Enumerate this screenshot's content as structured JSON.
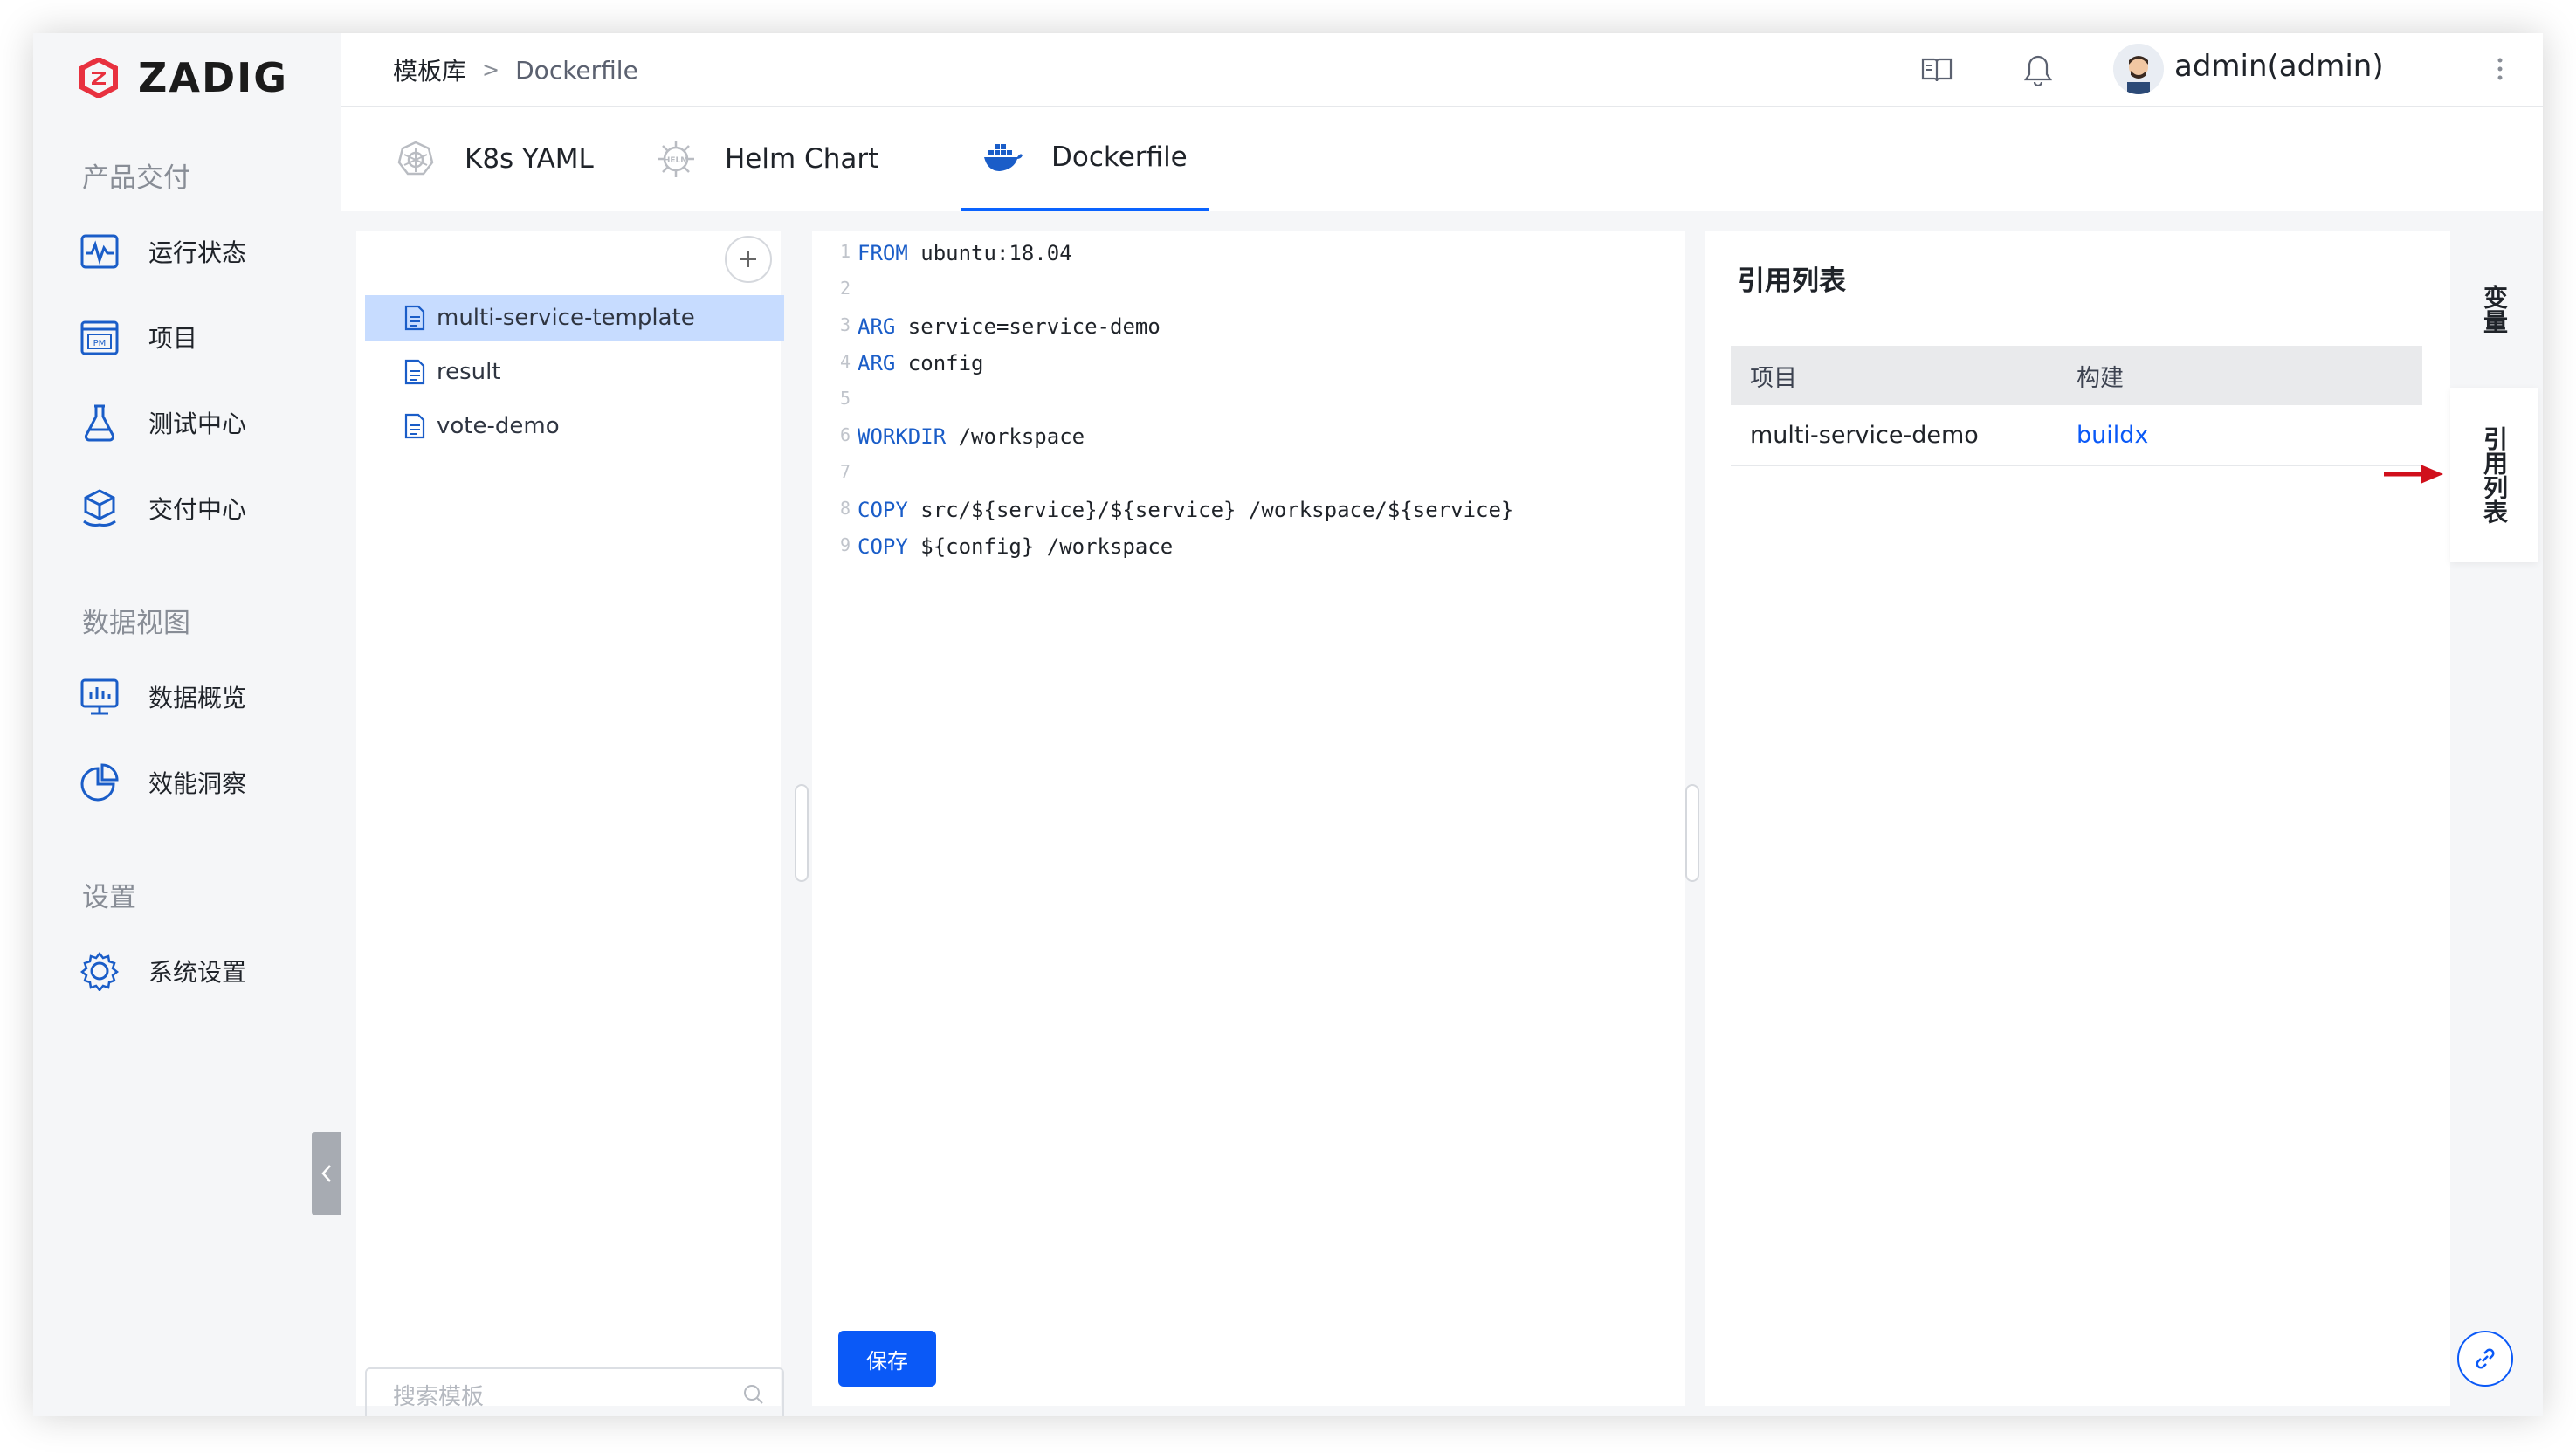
{
  "app": {
    "brand": "ZADIG"
  },
  "sidebar": {
    "section_delivery": "产品交付",
    "section_data": "数据视图",
    "section_settings": "设置",
    "items": [
      {
        "label": "运行状态",
        "icon": "pulse-monitor-icon"
      },
      {
        "label": "项目",
        "icon": "project-pm-icon"
      },
      {
        "label": "测试中心",
        "icon": "flask-icon"
      },
      {
        "label": "交付中心",
        "icon": "package-icon"
      },
      {
        "label": "数据概览",
        "icon": "bar-chart-monitor-icon"
      },
      {
        "label": "效能洞察",
        "icon": "pie-chart-icon"
      },
      {
        "label": "系统设置",
        "icon": "gear-icon"
      }
    ]
  },
  "header": {
    "breadcrumb_root": "模板库",
    "breadcrumb_sep": ">",
    "breadcrumb_current": "Dockerfile",
    "username": "admin(admin)"
  },
  "tabs": [
    {
      "label": "K8s YAML",
      "icon": "kubernetes-icon"
    },
    {
      "label": "Helm Chart",
      "icon": "helm-icon"
    },
    {
      "label": "Dockerfile",
      "icon": "docker-icon",
      "active": true
    }
  ],
  "files": {
    "items": [
      "multi-service-template",
      "result",
      "vote-demo"
    ],
    "selected": "multi-service-template",
    "search_placeholder": "搜索模板"
  },
  "editor": {
    "lines": [
      {
        "n": "1",
        "kw": "FROM",
        "rest": " ubuntu:18.04"
      },
      {
        "n": "2",
        "kw": "",
        "rest": ""
      },
      {
        "n": "3",
        "kw": "ARG",
        "rest": " service=service-demo"
      },
      {
        "n": "4",
        "kw": "ARG",
        "rest": " config"
      },
      {
        "n": "5",
        "kw": "",
        "rest": ""
      },
      {
        "n": "6",
        "kw": "WORKDIR",
        "rest": " /workspace"
      },
      {
        "n": "7",
        "kw": "",
        "rest": ""
      },
      {
        "n": "8",
        "kw": "COPY",
        "rest": " src/${service}/${service} /workspace/${service}"
      },
      {
        "n": "9",
        "kw": "COPY",
        "rest": " ${config} /workspace"
      }
    ],
    "save_label": "保存"
  },
  "references": {
    "title": "引用列表",
    "columns": [
      "项目",
      "构建"
    ],
    "rows": [
      {
        "project": "multi-service-demo",
        "build": "buildx"
      }
    ]
  },
  "side_tabs": {
    "variables": "变量",
    "references": "引用列表"
  },
  "colors": {
    "accent": "#0a59f7",
    "brand_red": "#e8313f",
    "selected_row": "#c7dcff",
    "annotation_arrow": "#d0101c"
  }
}
